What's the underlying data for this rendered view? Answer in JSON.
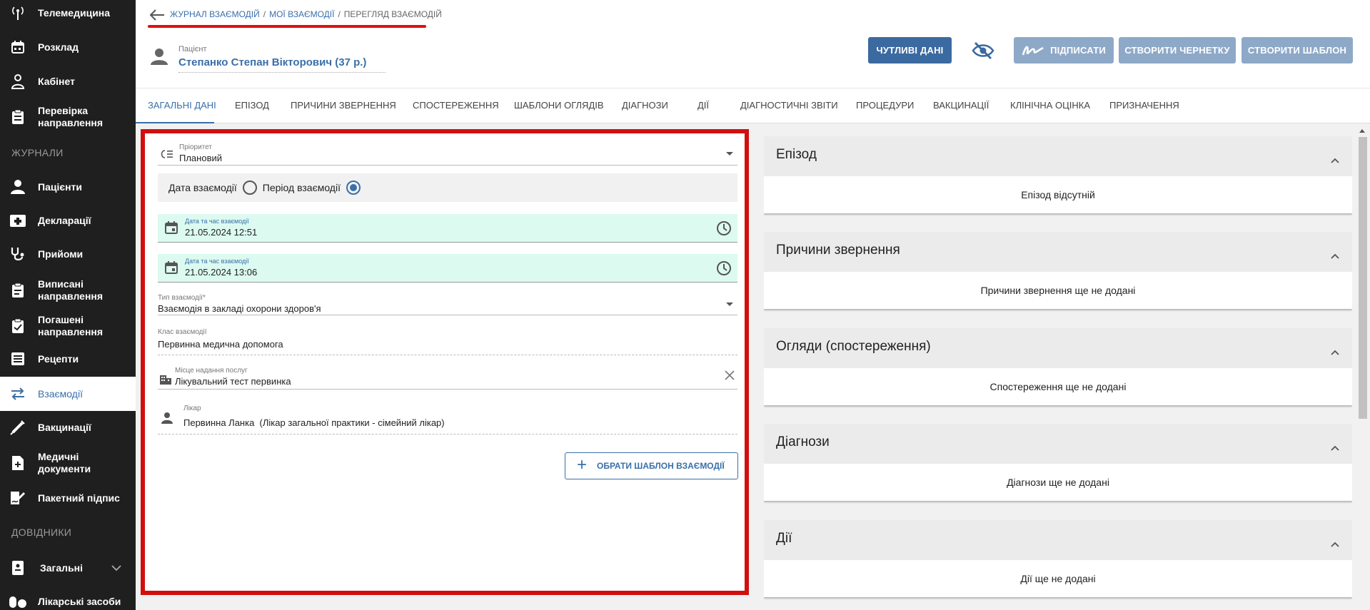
{
  "sidebar": {
    "items": [
      {
        "label": "Телемедицина",
        "icon": "antenna-icon",
        "name": "sidebar-item-telemedicine"
      },
      {
        "label": "Розклад",
        "icon": "calendar-icon",
        "name": "sidebar-item-schedule"
      },
      {
        "label": "Кабінет",
        "icon": "doctor-icon",
        "name": "sidebar-item-cabinet"
      },
      {
        "label": "Перевірка направлення",
        "icon": "clipboard-check-icon",
        "name": "sidebar-item-referral-check"
      },
      {
        "label": "Пацієнти",
        "icon": "person-icon",
        "name": "sidebar-item-patients"
      },
      {
        "label": "Декларації",
        "icon": "medical-folder-icon",
        "name": "sidebar-item-declarations"
      },
      {
        "label": "Прийоми",
        "icon": "stethoscope-icon",
        "name": "sidebar-item-appointments"
      },
      {
        "label": "Виписані направлення",
        "icon": "clipboard-icon",
        "name": "sidebar-item-issued-referrals"
      },
      {
        "label": "Погашені направлення",
        "icon": "clipboard-done-icon",
        "name": "sidebar-item-redeemed-referrals"
      },
      {
        "label": "Рецепти",
        "icon": "list-icon",
        "name": "sidebar-item-prescriptions"
      },
      {
        "label": "Взаємодії",
        "icon": "swap-arrows-icon",
        "name": "sidebar-item-encounters"
      },
      {
        "label": "Вакцинації",
        "icon": "syringe-icon",
        "name": "sidebar-item-vaccinations"
      },
      {
        "label": "Медичні документи",
        "icon": "document-plus-icon",
        "name": "sidebar-item-medical-documents"
      },
      {
        "label": "Пакетний підпис",
        "icon": "sign-document-icon",
        "name": "sidebar-item-batch-sign"
      },
      {
        "label": "Загальні",
        "icon": "book-icon",
        "name": "sidebar-item-general"
      },
      {
        "label": "Лікарські засоби",
        "icon": "pills-icon",
        "name": "sidebar-item-medicines"
      }
    ],
    "section_journals": "ЖУРНАЛИ",
    "section_references": "ДОВІДНИКИ"
  },
  "breadcrumb": {
    "part1": "ЖУРНАЛ ВЗАЄМОДІЙ",
    "part2": "МОЇ ВЗАЄМОДІЇ",
    "current": "ПЕРЕГЛЯД ВЗАЄМОДІЙ",
    "separator": "/"
  },
  "patient": {
    "label": "Пацієнт",
    "name": "Степанко Степан Вікторович (37 р.)"
  },
  "buttons": {
    "sensitive": "ЧУТЛИВІ ДАНІ",
    "sign": "ПІДПИСАТИ",
    "draft": "СТВОРИТИ ЧЕРНЕТКУ",
    "template": "СТВОРИТИ ШАБЛОН"
  },
  "tabs": [
    "ЗАГАЛЬНІ ДАНІ",
    "ЕПІЗОД",
    "ПРИЧИНИ ЗВЕРНЕННЯ",
    "СПОСТЕРЕЖЕННЯ",
    "ШАБЛОНИ ОГЛЯДІВ",
    "ДІАГНОЗИ",
    "ДІЇ",
    "ДІАГНОСТИЧНІ ЗВІТИ",
    "ПРОЦЕДУРИ",
    "ВАКЦИНАЦІЇ",
    "КЛІНІЧНА ОЦІНКА",
    "ПРИЗНАЧЕННЯ"
  ],
  "form": {
    "priority_label": "Пріоритет",
    "priority_value": "Плановий",
    "radio_date": "Дата взаємодії",
    "radio_period": "Період взаємодії",
    "radio_selected": "Період взаємодії",
    "start_label": "Дата та час взаємодії",
    "start_value": "21.05.2024 12:51",
    "end_label": "Дата та час взаємодії",
    "end_value": "21.05.2024 13:06",
    "type_label": "Тип взаємодії*",
    "type_value": "Взаємодія в закладі охорони здоров'я",
    "class_label": "Клас взаємодії",
    "class_value": "Первинна медична допомога",
    "place_label": "Місце надання послуг",
    "place_value": "Лікувальний тест первинка",
    "doctor_label": "Лікар",
    "doctor_value": "Первинна Ланка  (Лікар загальної практики - сімейний лікар)",
    "template_button": "ОБРАТИ ШАБЛОН ВЗАЄМОДІЇ"
  },
  "accordions": [
    {
      "title": "Епізод",
      "empty": "Епізод відсутній"
    },
    {
      "title": "Причини звернення",
      "empty": "Причини звернення ще не додані"
    },
    {
      "title": "Огляди (спостереження)",
      "empty": "Спостереження ще не додані"
    },
    {
      "title": "Діагнози",
      "empty": "Діагнози ще не додані"
    },
    {
      "title": "Дії",
      "empty": "Дії ще не додані"
    }
  ],
  "colors": {
    "accent": "#3a6fa8",
    "sidebar_bg": "#1f1f1f",
    "highlight_border": "#d10f0f",
    "date_field_bg": "#dcfaf0"
  }
}
